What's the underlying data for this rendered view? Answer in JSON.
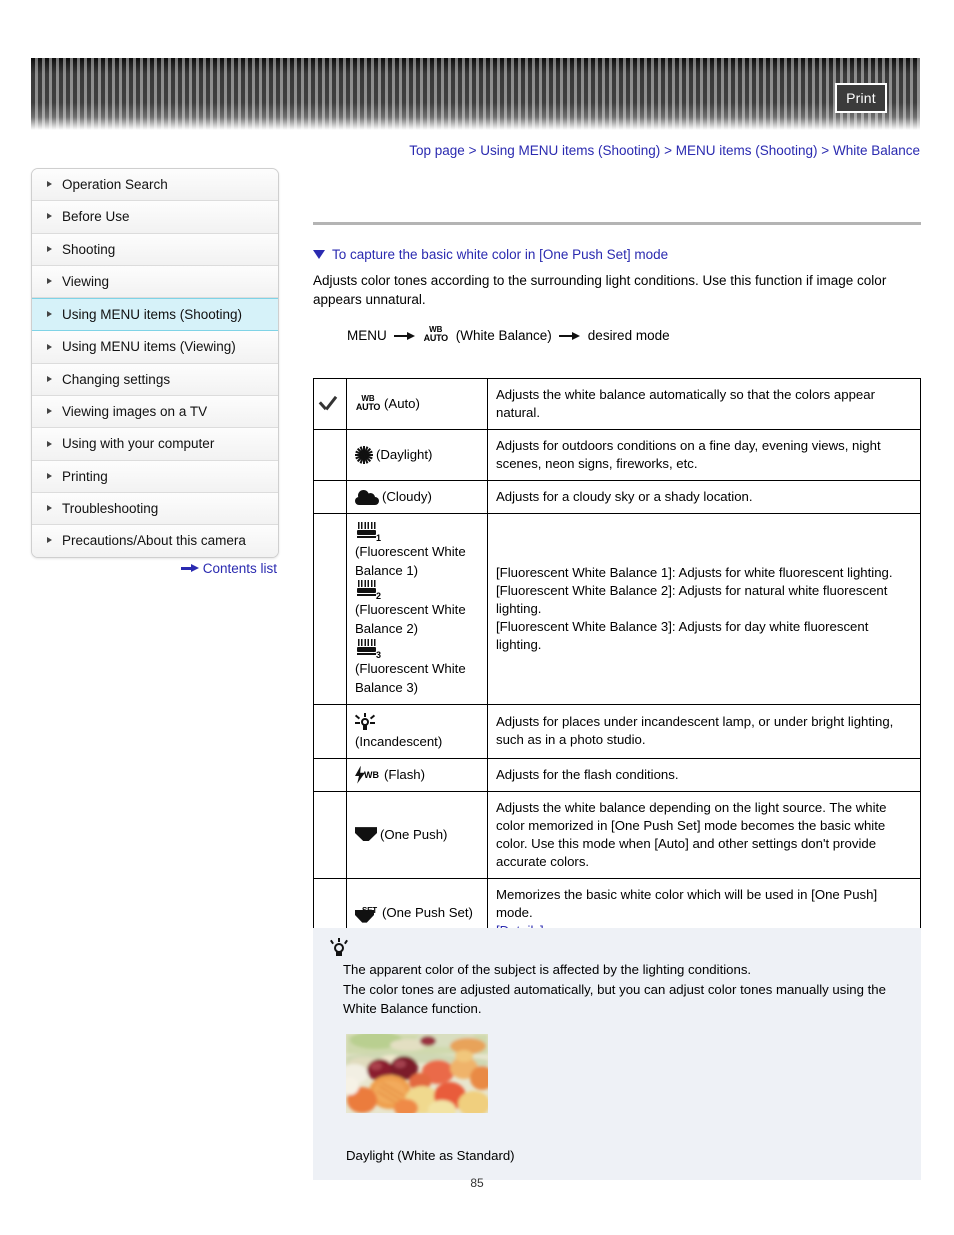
{
  "header": {
    "print_label": "Print"
  },
  "breadcrumb": {
    "items": [
      "Top page",
      "Using MENU items (Shooting)",
      "MENU items (Shooting)",
      "White Balance"
    ],
    "separator": ">"
  },
  "sidebar": {
    "items": [
      {
        "label": "Operation Search",
        "active": false
      },
      {
        "label": "Before Use",
        "active": false
      },
      {
        "label": "Shooting",
        "active": false
      },
      {
        "label": "Viewing",
        "active": false
      },
      {
        "label": "Using MENU items (Shooting)",
        "active": true
      },
      {
        "label": "Using MENU items (Viewing)",
        "active": false
      },
      {
        "label": "Changing settings",
        "active": false
      },
      {
        "label": "Viewing images on a TV",
        "active": false
      },
      {
        "label": "Using with your computer",
        "active": false
      },
      {
        "label": "Printing",
        "active": false
      },
      {
        "label": "Troubleshooting",
        "active": false
      },
      {
        "label": "Precautions/About this camera",
        "active": false
      }
    ],
    "contents_link": "Contents list"
  },
  "main": {
    "section_heading": "To capture the basic white color in [One Push Set] mode",
    "intro": "Adjusts color tones according to the surrounding light conditions. Use this function if image color appears unnatural.",
    "menu_path": {
      "start": "MENU",
      "icon_top": "WB",
      "icon_bottom": "AUTO",
      "icon_label": "(White Balance)",
      "end": "desired mode"
    },
    "table": {
      "rows": [
        {
          "checked": true,
          "icon": "wb-auto-icon",
          "label": "(Auto)",
          "desc": "Adjusts the white balance automatically so that the colors appear natural."
        },
        {
          "checked": false,
          "icon": "daylight-sun-icon",
          "label": "(Daylight)",
          "desc": "Adjusts for outdoors conditions on a fine day, evening views, night scenes, neon signs, fireworks, etc."
        },
        {
          "checked": false,
          "icon": "cloudy-icon",
          "label": "(Cloudy)",
          "desc": "Adjusts for a cloudy sky or a shady location."
        },
        {
          "checked": false,
          "icon": "fluorescent-icon",
          "label_1": "(Fluorescent White Balance 1)",
          "label_2": "(Fluorescent White Balance 2)",
          "label_3": "(Fluorescent White Balance 3)",
          "num_1": "1",
          "num_2": "2",
          "num_3": "3",
          "desc_line1": "[Fluorescent White Balance 1]: Adjusts for white fluorescent lighting.",
          "desc_line2": "[Fluorescent White Balance 2]: Adjusts for natural white fluorescent lighting.",
          "desc_line3": "[Fluorescent White Balance 3]: Adjusts for day white fluorescent lighting."
        },
        {
          "checked": false,
          "icon": "incandescent-icon",
          "label": "(Incandescent)",
          "desc": "Adjusts for places under incandescent lamp, or under bright lighting, such as in a photo studio."
        },
        {
          "checked": false,
          "icon": "flash-icon",
          "icon_text": "WB",
          "label": "(Flash)",
          "desc": "Adjusts for the flash conditions."
        },
        {
          "checked": false,
          "icon": "one-push-icon",
          "label": "(One Push)",
          "desc": "Adjusts the white balance depending on the light source. The white color memorized in [One Push Set] mode becomes the basic white color. Use this mode when [Auto] and other settings don't provide accurate colors."
        },
        {
          "checked": false,
          "icon": "one-push-set-icon",
          "icon_text": "SET",
          "label": "(One Push Set)",
          "desc": "Memorizes the basic white color which will be used in [One Push] mode.",
          "link": "[Details]"
        }
      ]
    }
  },
  "tip": {
    "line1": "The apparent color of the subject is affected by the lighting conditions.",
    "line2": "The color tones are adjusted automatically, but you can adjust color tones manually using the White Balance function.",
    "photo_caption": "Daylight (White as Standard)",
    "photo_alt": "fruit-salad-photo"
  },
  "page_number": "85",
  "colors": {
    "link": "#2a2ab0",
    "sidebar_active": "#d6f2f9",
    "sidebar_active_border": "#7fd3e6",
    "tip_bg": "#eef1f6",
    "rule": "#b4b4b4"
  }
}
